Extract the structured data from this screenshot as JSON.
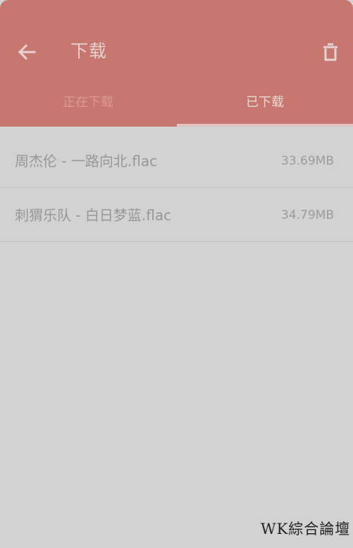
{
  "header": {
    "title": "下载",
    "back_icon": "arrow-left-icon",
    "delete_icon": "trash-icon",
    "background_color": "#c87770"
  },
  "tabs": [
    {
      "label": "正在下载",
      "selected": false
    },
    {
      "label": "已下载",
      "selected": true
    }
  ],
  "downloads": [
    {
      "name": "周杰伦 - 一路向北.flac",
      "size": "33.69MB"
    },
    {
      "name": "刺猬乐队 - 白日梦蓝.flac",
      "size": "34.79MB"
    }
  ],
  "watermark": "WK綜合論壇"
}
